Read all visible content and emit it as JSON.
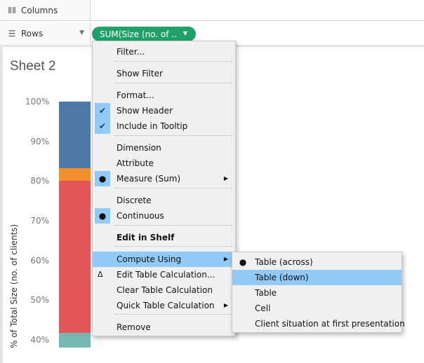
{
  "shelves": {
    "columns": {
      "icon": "columns-icon",
      "label": "Columns"
    },
    "rows": {
      "icon": "rows-icon",
      "label": "Rows",
      "pill_label": "SUM(Size (no. of .."
    }
  },
  "sheet": {
    "title": "Sheet 2",
    "axis_title": "% of Total Size (no. of clients)",
    "ticks": [
      "100%",
      "90%",
      "80%",
      "70%",
      "60%",
      "50%",
      "40%"
    ]
  },
  "chart_data": {
    "type": "bar",
    "ylabel": "% of Total Size (no. of clients)",
    "ylim_visible": [
      0.38,
      1.0
    ],
    "series": [
      {
        "color": "#4e79a7",
        "from": 0.833,
        "to": 1.0
      },
      {
        "color": "#f28e2b",
        "from": 0.8,
        "to": 0.833
      },
      {
        "color": "#e15759",
        "from": 0.418,
        "to": 0.8
      },
      {
        "color": "#76b7b2",
        "from": 0.38,
        "to": 0.418
      }
    ]
  },
  "menu": {
    "items": [
      {
        "label": "Filter...",
        "name": "menu-filter"
      },
      {
        "label": "Show Filter",
        "name": "menu-show-filter"
      },
      {
        "label": "Format...",
        "name": "menu-format"
      },
      {
        "label": "Show Header",
        "name": "menu-show-header",
        "checked": true
      },
      {
        "label": "Include in Tooltip",
        "name": "menu-include-in-tooltip",
        "checked": true
      },
      {
        "label": "Dimension",
        "name": "menu-dimension"
      },
      {
        "label": "Attribute",
        "name": "menu-attribute"
      },
      {
        "label": "Measure (Sum)",
        "name": "menu-measure-sum",
        "selected": true,
        "submenu": true
      },
      {
        "label": "Discrete",
        "name": "menu-discrete"
      },
      {
        "label": "Continuous",
        "name": "menu-continuous",
        "selected": true
      },
      {
        "label": "Edit in Shelf",
        "name": "menu-edit-in-shelf"
      },
      {
        "label": "Compute Using",
        "name": "menu-compute-using",
        "submenu": true,
        "highlighted": true
      },
      {
        "label": "Edit Table Calculation...",
        "name": "menu-edit-table-calculation"
      },
      {
        "label": "Clear Table Calculation",
        "name": "menu-clear-table-calculation"
      },
      {
        "label": "Quick Table Calculation",
        "name": "menu-quick-table-calculation",
        "submenu": true
      },
      {
        "label": "Remove",
        "name": "menu-remove"
      }
    ]
  },
  "submenu": {
    "items": [
      {
        "label": "Table (across)",
        "name": "submenu-table-across",
        "selected": true
      },
      {
        "label": "Table (down)",
        "name": "submenu-table-down",
        "highlighted": true
      },
      {
        "label": "Table",
        "name": "submenu-table"
      },
      {
        "label": "Cell",
        "name": "submenu-cell"
      },
      {
        "label": "Client situation at first presentation",
        "name": "submenu-client-situation"
      }
    ]
  }
}
